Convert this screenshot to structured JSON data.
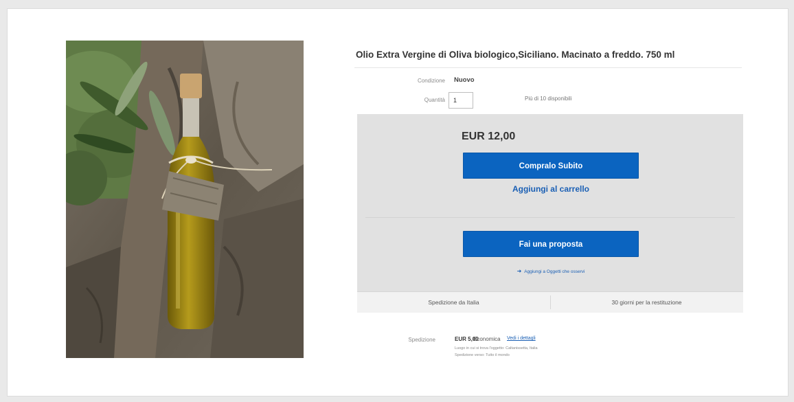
{
  "listing": {
    "title": "Olio Extra Vergine di Oliva biologico,Siciliano. Macinato a freddo. 750 ml",
    "image_alt": "Bottiglia di olio extra vergine di oliva"
  },
  "details": {
    "condition_label": "Condizione",
    "condition_value": "Nuovo",
    "quantity_label": "Quantità",
    "quantity_value": "1",
    "availability": "Più di 10 disponibili"
  },
  "purchase": {
    "price": "EUR 12,00",
    "buy_now": "Compralo Subito",
    "add_to_cart": "Aggiungi al carrello",
    "make_offer": "Fai una proposta",
    "watch": "Aggiungi a Oggetti che osservi"
  },
  "info_bar": {
    "shipping_from": "Spedizione da Italia",
    "returns": "30 giorni per la restituzione"
  },
  "shipping": {
    "label": "Spedizione",
    "price": "EUR 5,00",
    "type": "Economica",
    "details_link": "Vedi i dettagli",
    "note_location": "Luogo in cui si trova l'oggetto: Caltanissetta, Italia",
    "note_destination": "Spedizione verso: Tutto il mondo"
  },
  "colors": {
    "primary_button": "#0b64c0",
    "link": "#1a5fb4",
    "panel": "#e1e1e1"
  }
}
